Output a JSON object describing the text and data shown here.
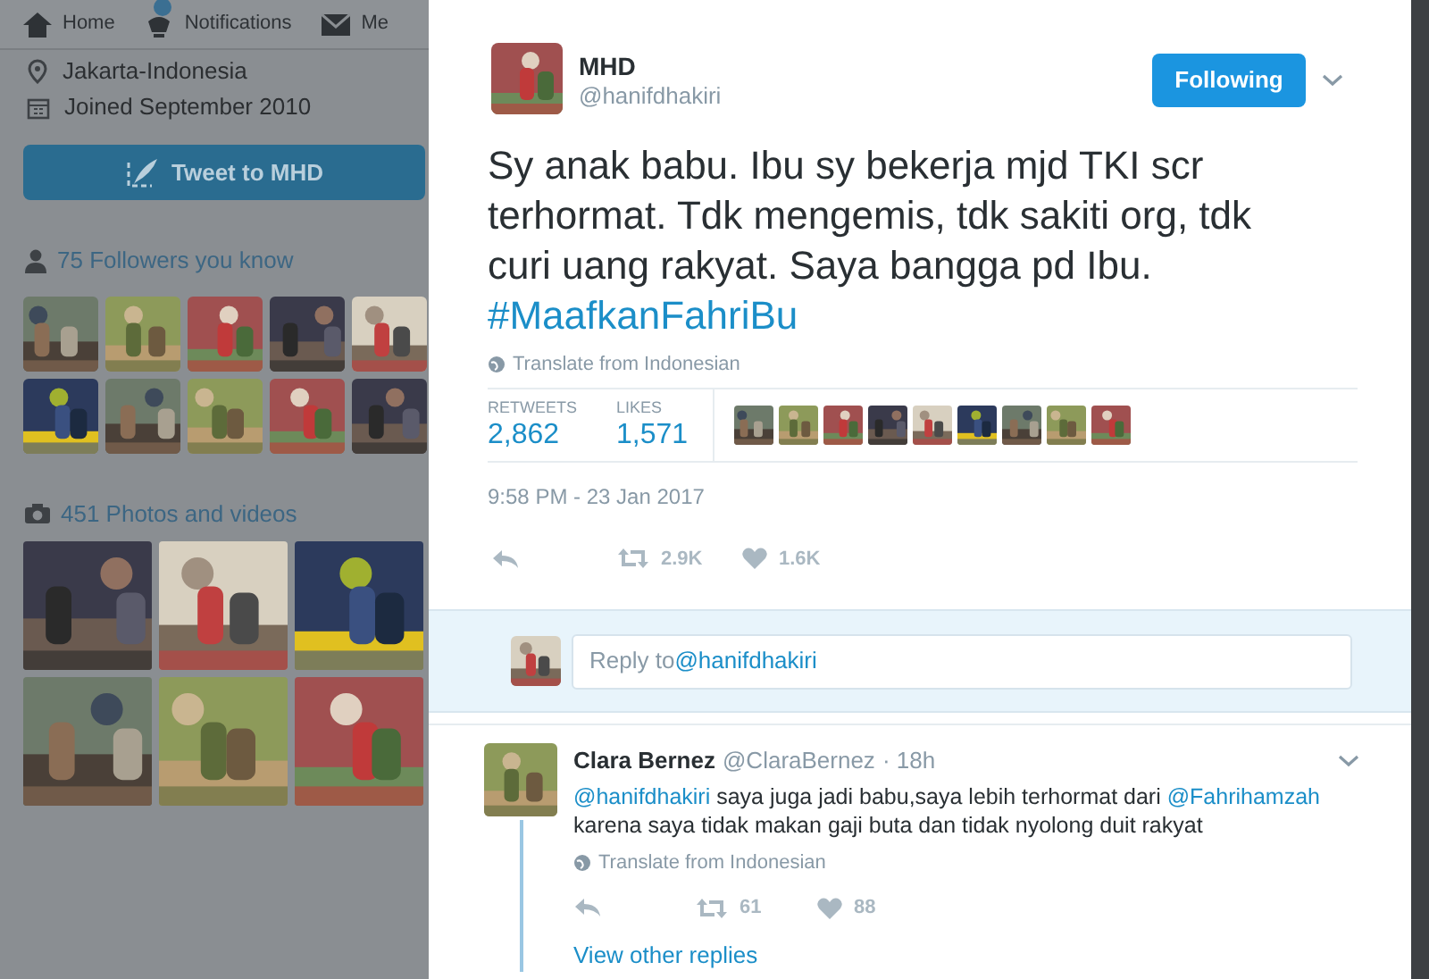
{
  "nav": {
    "items": [
      {
        "kind": "home",
        "label": "Home"
      },
      {
        "kind": "notifications",
        "label": "Notifications"
      },
      {
        "kind": "messages",
        "label": "Me"
      }
    ]
  },
  "profile": {
    "location": "Jakarta-Indonesia",
    "joined": "Joined September 2010",
    "tweet_button": "Tweet to MHD",
    "followers_you_know": {
      "label": "75 Followers you know"
    },
    "photos": {
      "label": "451 Photos and videos"
    }
  },
  "tweet": {
    "name": "MHD",
    "handle": "@hanifdhakiri",
    "follow_button": "Following",
    "text": "Sy anak babu. Ibu sy bekerja mjd TKI scr terhormat. Tdk mengemis, tdk sakiti org, tdk curi uang rakyat. Saya bangga pd Ibu.",
    "hashtag": "#MaafkanFahriBu",
    "translate": "Translate from Indonesian",
    "stats": [
      {
        "label": "RETWEETS",
        "value": "2,862"
      },
      {
        "label": "LIKES",
        "value": "1,571"
      }
    ],
    "timestamp": "9:58 PM - 23 Jan 2017",
    "actions": [
      {
        "kind": "reply"
      },
      {
        "kind": "retweet",
        "count": "2.9K"
      },
      {
        "kind": "like",
        "count": "1.6K"
      }
    ]
  },
  "reply_box": {
    "prefix": "Reply to ",
    "mention": "@hanifdhakiri"
  },
  "replies": [
    {
      "name": "Clara Bernez",
      "handle": "@ClaraBernez",
      "time": "· 18h",
      "parts": [
        {
          "kind": "mention",
          "text": "@hanifdhakiri"
        },
        {
          "kind": "text",
          "text": " saya juga jadi babu,saya lebih terhormat dari "
        },
        {
          "kind": "mention",
          "text": "@Fahrihamzah"
        },
        {
          "kind": "text",
          "text": " karena saya tidak makan gaji buta dan tidak nyolong duit rakyat"
        }
      ],
      "translate": "Translate from Indonesian",
      "actions": [
        {
          "kind": "reply"
        },
        {
          "kind": "retweet",
          "count": "61"
        },
        {
          "kind": "like",
          "count": "88"
        }
      ],
      "more": "View other replies"
    }
  ]
}
